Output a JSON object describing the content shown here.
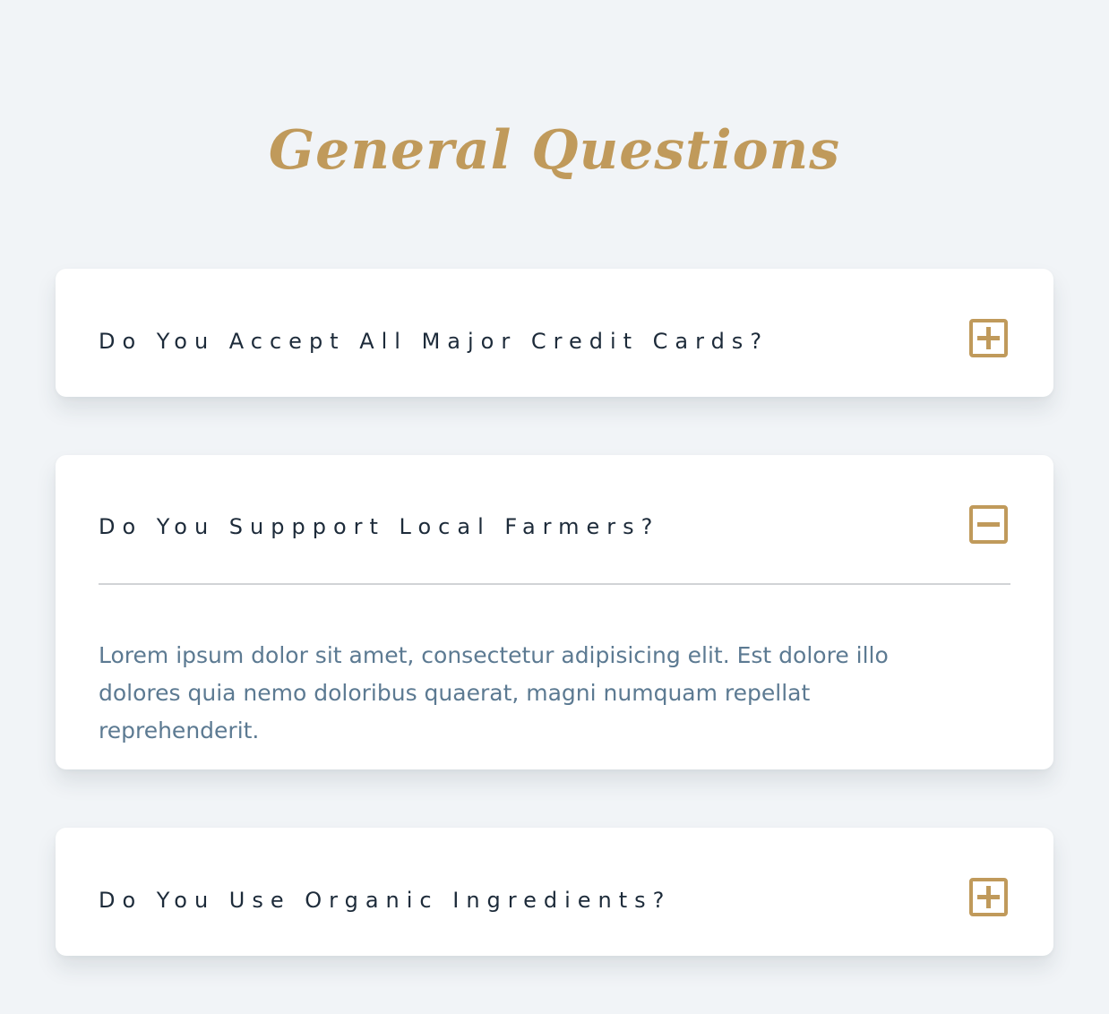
{
  "page": {
    "title": "General Questions"
  },
  "faq": {
    "items": [
      {
        "question": "Do You Accept All Major Credit Cards?",
        "expanded": false,
        "icon": "plus-square-icon"
      },
      {
        "question": "Do You Suppport Local Farmers?",
        "expanded": true,
        "icon": "minus-square-icon",
        "answer": "Lorem ipsum dolor sit amet, consectetur adipisicing elit. Est dolore illo dolores quia nemo doloribus quaerat, magni numquam repellat reprehenderit."
      },
      {
        "question": "Do You Use Organic Ingredients?",
        "expanded": false,
        "icon": "plus-square-icon"
      }
    ]
  },
  "colors": {
    "background": "#f1f4f7",
    "accent": "#c09a5b",
    "question_text": "#1d2b3a",
    "answer_text": "#5c7a92",
    "card": "#ffffff"
  }
}
